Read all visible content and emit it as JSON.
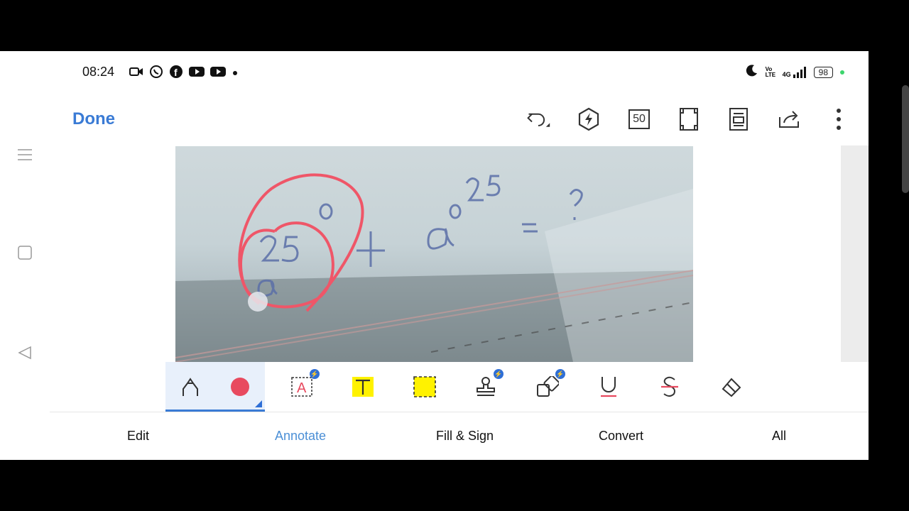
{
  "status_bar": {
    "time": "08:24",
    "left_icons": [
      "video-camera-icon",
      "whatsapp-icon",
      "facebook-icon",
      "youtube-icon",
      "youtube-icon",
      "dot-icon"
    ],
    "right_icons": [
      "moon-icon",
      "volte-icon",
      "signal-4g-icon"
    ],
    "network": "4G",
    "volte": "Vo LTE",
    "battery": "98"
  },
  "app_bar": {
    "done_label": "Done",
    "zoom": "50",
    "tools": [
      "undo-icon",
      "ai-bolt-icon",
      "zoom-50-icon",
      "fullscreen-icon",
      "page-layout-icon",
      "share-icon",
      "more-icon"
    ]
  },
  "side_nav": [
    "menu-icon",
    "square-icon",
    "back-triangle-icon"
  ],
  "document": {
    "equation_visible": "a^25^0 + a^0^25 = ?"
  },
  "annotate_tools": [
    {
      "name": "pen",
      "icon": "pen-icon",
      "active": true
    },
    {
      "name": "color",
      "icon": "color-dot-icon",
      "color": "#e84a5f",
      "active": true
    },
    {
      "name": "text-box",
      "icon": "text-box-icon",
      "pro": true
    },
    {
      "name": "highlight-text",
      "icon": "text-highlight-icon",
      "color": "#fff200"
    },
    {
      "name": "area-highlight",
      "icon": "area-highlight-icon",
      "color": "#fff200"
    },
    {
      "name": "stamp",
      "icon": "stamp-icon",
      "pro": true
    },
    {
      "name": "shapes",
      "icon": "shapes-icon",
      "pro": true
    },
    {
      "name": "underline",
      "icon": "underline-icon"
    },
    {
      "name": "strikethrough",
      "icon": "strikethrough-icon"
    },
    {
      "name": "eraser",
      "icon": "eraser-icon"
    }
  ],
  "tabs": [
    {
      "label": "Edit",
      "active": false
    },
    {
      "label": "Annotate",
      "active": true
    },
    {
      "label": "Fill & Sign",
      "active": false
    },
    {
      "label": "Convert",
      "active": false
    },
    {
      "label": "All",
      "active": false
    }
  ],
  "colors": {
    "accent": "#3a7bd5",
    "tab_active": "#4b8fd6",
    "ink": "#e84a5f",
    "highlight": "#fff200"
  }
}
